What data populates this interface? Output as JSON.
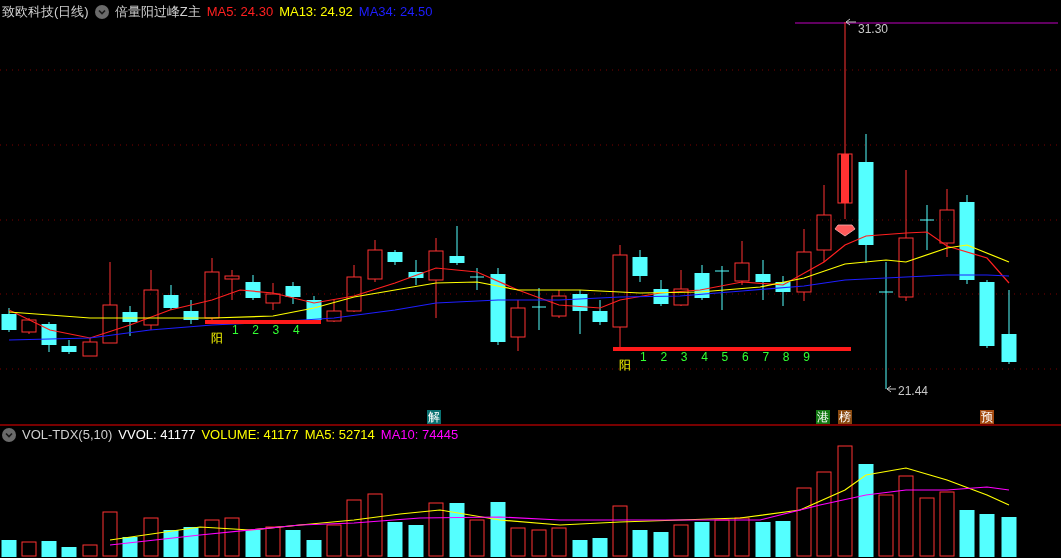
{
  "main_header": {
    "stock": "致欧科技(日线)",
    "indicator": "倍量阳过峰Z主",
    "ma": [
      {
        "label": "MA5: 24.30",
        "color": "#ff2020"
      },
      {
        "label": "MA13: 24.92",
        "color": "#ffff00"
      },
      {
        "label": "MA34: 24.50",
        "color": "#1e1eff"
      }
    ]
  },
  "price_labels": [
    {
      "kind": "high",
      "text": "31.30"
    },
    {
      "kind": "low",
      "text": "21.44"
    }
  ],
  "signals": [
    {
      "label": "阳",
      "numbers": [
        "1",
        "2",
        "3",
        "4"
      ]
    },
    {
      "label": "阳",
      "numbers": [
        "1",
        "2",
        "3",
        "4",
        "5",
        "6",
        "7",
        "8",
        "9"
      ]
    }
  ],
  "event_badges": [
    {
      "text": "解",
      "color": "#0a7272"
    },
    {
      "text": "港",
      "color": "#137a13"
    },
    {
      "text": "榜",
      "color": "#8a4a10"
    },
    {
      "text": "预",
      "color": "#a44a10"
    }
  ],
  "volume_header": {
    "indicator": "VOL-TDX(5,10)",
    "values": [
      {
        "label": "VVOL: 41177",
        "color": "#ffffff"
      },
      {
        "label": "VOLUME: 41177",
        "color": "#ffff00"
      },
      {
        "label": "MA5: 52714",
        "color": "#ffff00"
      },
      {
        "label": "MA10: 74445",
        "color": "#ff00ff"
      }
    ]
  }
}
